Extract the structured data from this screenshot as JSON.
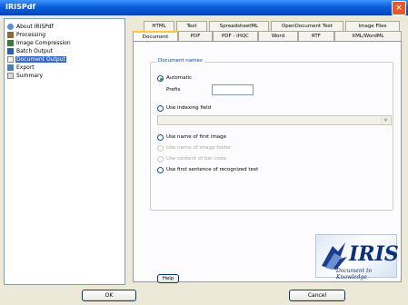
{
  "window": {
    "title": "IRISPdf",
    "close_glyph": "×"
  },
  "tree": {
    "items": [
      {
        "label": "About IRISPdf",
        "icon": "info-icon"
      },
      {
        "label": "Processing",
        "icon": "processing-icon"
      },
      {
        "label": "Image Compression",
        "icon": "compression-icon"
      },
      {
        "label": "Batch Output",
        "icon": "batch-icon"
      },
      {
        "label": "Document Output",
        "icon": "document-icon",
        "selected": true
      },
      {
        "label": "Export",
        "icon": "export-icon"
      },
      {
        "label": "Summary",
        "icon": "summary-icon"
      }
    ]
  },
  "tabs": {
    "row1": [
      "HTML",
      "Text",
      "SpreadsheetML",
      "OpenDocument Text",
      "Image Files"
    ],
    "row2": [
      "Document Names",
      "PDF",
      "PDF - iHQC",
      "Word",
      "RTF",
      "XML/WordML"
    ],
    "active": "Document Names"
  },
  "document_names": {
    "legend": "Document names",
    "automatic_label": "Automatic",
    "prefix_label": "Prefix",
    "prefix_value": "",
    "indexing_label": "Use indexing field",
    "first_image_label": "Use name of first image",
    "image_folder_label": "Use name of image folder",
    "barcode_label": "Use content of bar code",
    "first_sentence_label": "Use first sentence of recognized text"
  },
  "logo": {
    "brand": "IRIS",
    "tagline": "Document to Knowledge"
  },
  "buttons": {
    "help": "Help",
    "ok": "OK",
    "cancel": "Cancel"
  }
}
